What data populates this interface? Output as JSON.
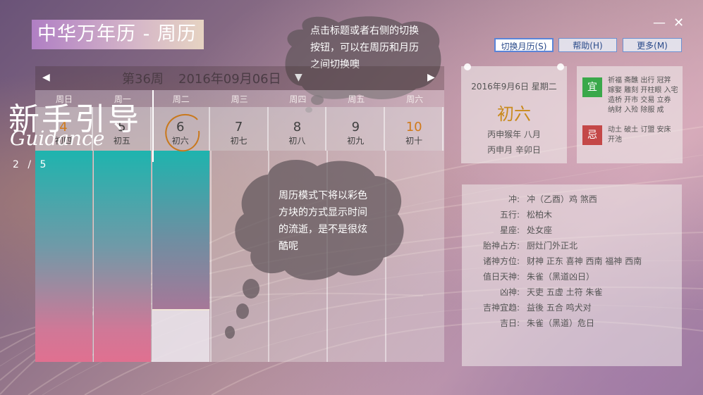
{
  "app": {
    "title": "中华万年历 - 周历",
    "minimize": "—",
    "close": "✕"
  },
  "toolbar": {
    "switch_label": "切换月历(S)",
    "help_label": "帮助(H)",
    "more_label": "更多(M)"
  },
  "tips": {
    "top": [
      "点击标题或者右侧的切换",
      "按钮，可以在周历和月历",
      "之间切换噢"
    ],
    "middle": [
      "周历模式下将以彩色",
      "方块的方式显示时间",
      "的流逝，是不是很炫",
      "酷呢"
    ]
  },
  "week": {
    "label": "第36周",
    "date": "2016年09月06日",
    "prev_icon": "◀",
    "next_icon": "▶",
    "dropdown_icon": "▼",
    "weekdays": [
      "周日",
      "周一",
      "周二",
      "周三",
      "周四",
      "周五",
      "周六"
    ],
    "days": [
      {
        "num": "4",
        "lunar": "初四",
        "weekend": true
      },
      {
        "num": "5",
        "lunar": "初五",
        "weekend": false
      },
      {
        "num": "6",
        "lunar": "初六",
        "weekend": false
      },
      {
        "num": "7",
        "lunar": "初七",
        "weekend": false
      },
      {
        "num": "8",
        "lunar": "初八",
        "weekend": false
      },
      {
        "num": "9",
        "lunar": "初九",
        "weekend": false
      },
      {
        "num": "10",
        "lunar": "初十",
        "weekend": true
      }
    ],
    "elapsed_fraction": [
      1.0,
      1.0,
      0.75,
      0,
      0,
      0,
      0
    ]
  },
  "guide": {
    "title": "新手引导",
    "subtitle": "Guidance",
    "page": "2 / 5"
  },
  "date_card": {
    "solar": "2016年9月6日 星期二",
    "lunar_day": "初六",
    "year": "丙申猴年 八月",
    "ganzhi": "丙申月 辛卯日"
  },
  "yiji": {
    "yi_label": "宜",
    "yi_text": "祈福 斋醮 出行 冠笄 嫁娶 雕刻 开柱眼 入宅 造桥 开市 交易 立券 纳财 入殓 除服 成",
    "ji_label": "忌",
    "ji_text": "动土 破土 订盟 安床 开池",
    "yi_color": "#3aa84a",
    "ji_color": "#c44848"
  },
  "info": [
    {
      "k": "冲:",
      "v": "冲（乙酉）鸡   煞西"
    },
    {
      "k": "五行:",
      "v": "松柏木"
    },
    {
      "k": "星座:",
      "v": "处女座"
    },
    {
      "k": "胎神占方:",
      "v": "厨灶门外正北"
    },
    {
      "k": "诸神方位:",
      "v": "财神 正东     喜神 西南     福神 西南"
    },
    {
      "k": "值日天神:",
      "v": "朱雀（黑道凶日）"
    },
    {
      "k": "凶神:",
      "v": "天吏 五虚 土符 朱雀"
    },
    {
      "k": "吉神宜趋:",
      "v": "益後 五合 鸣犬对"
    },
    {
      "k": "吉日:",
      "v": "朱雀（黑道）危日"
    }
  ]
}
